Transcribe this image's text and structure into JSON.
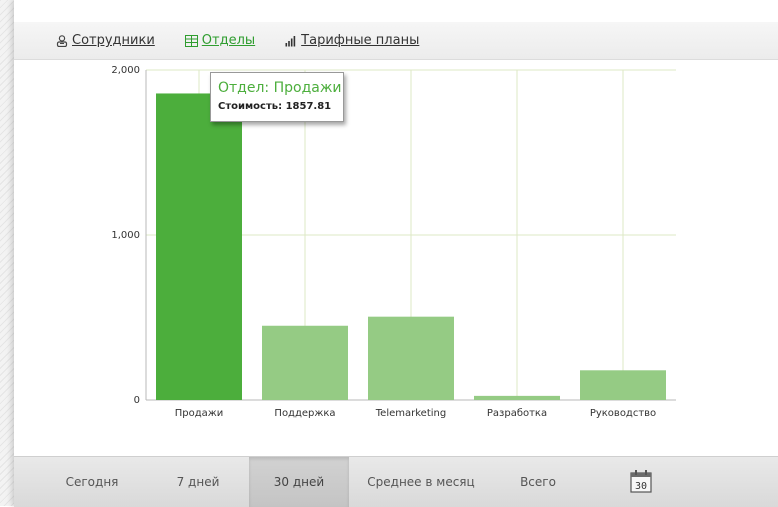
{
  "tabs": [
    {
      "label": "Сотрудники",
      "icon": "employees-icon",
      "active": false
    },
    {
      "label": "Отделы",
      "icon": "departments-icon",
      "active": true
    },
    {
      "label": "Тарифные планы",
      "icon": "tariff-plans-icon",
      "active": false
    }
  ],
  "tooltip": {
    "title": "Отдел: Продажи",
    "value_text": "Стоимость: 1857.81"
  },
  "periods": [
    {
      "label": "Сегодня",
      "selected": false
    },
    {
      "label": "7 дней",
      "selected": false
    },
    {
      "label": "30 дней",
      "selected": true
    },
    {
      "label": "Среднее в месяц",
      "selected": false
    },
    {
      "label": "Всего",
      "selected": false
    }
  ],
  "calendar_button": {
    "icon": "calendar-icon",
    "day": "30"
  },
  "colors": {
    "accent": "#2f9d2f",
    "bar_active": "#4cae3c",
    "bar_default": "#95cb84",
    "grid": "#dde8c6"
  },
  "chart_data": {
    "type": "bar",
    "categories": [
      "Продажи",
      "Поддержка",
      "Telemarketing",
      "Разработка",
      "Руководство"
    ],
    "values": [
      1857.81,
      450,
      505,
      25,
      180
    ],
    "highlighted_index": 0,
    "ylim": [
      0,
      2000
    ],
    "yticks": [
      0,
      1000,
      2000
    ],
    "ytick_labels": [
      "0",
      "1,000",
      "2,000"
    ],
    "grid": true
  }
}
